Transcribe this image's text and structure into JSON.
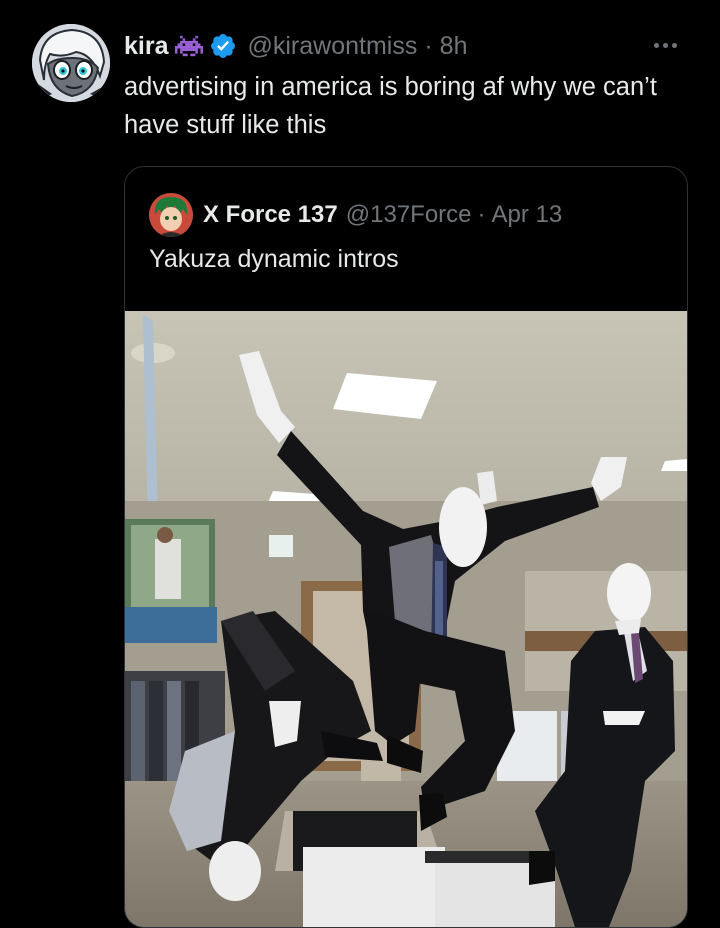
{
  "author": {
    "display_name": "kira",
    "handle": "@kirawontmiss",
    "separator": "·",
    "time": "8h",
    "badges": [
      "alien-monster-icon",
      "verified-badge-icon"
    ],
    "avatar": "cartoon-avatar-image"
  },
  "post": {
    "text": "advertising in america is boring af why we can’t have stuff like this"
  },
  "quoted": {
    "display_name": "X Force 137",
    "handle": "@137Force",
    "separator": "·",
    "date": "Apr 13",
    "text": "Yakuza dynamic intros",
    "media": "photo-mannequins-in-store"
  },
  "colors": {
    "background": "#000000",
    "text_primary": "#e7e9ea",
    "text_secondary": "#71767b",
    "verified_blue": "#1d9bf0",
    "alien_purple": "#9b5fd8",
    "card_border": "#2f3336"
  }
}
